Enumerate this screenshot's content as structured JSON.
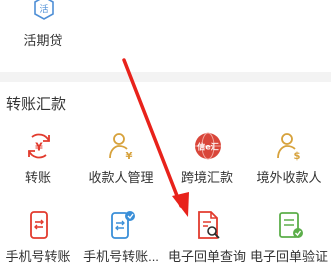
{
  "top": {
    "item_label": "活期贷",
    "icon_char": "活"
  },
  "section": {
    "title": "转账汇款"
  },
  "grid": {
    "row1": [
      {
        "label": "转账",
        "icon": "yen-transfer-icon"
      },
      {
        "label": "收款人管理",
        "icon": "payee-person-icon"
      },
      {
        "label": "跨境汇款",
        "icon": "globe-remit-icon",
        "badge": "信e汇"
      },
      {
        "label": "境外收款人",
        "icon": "overseas-payee-icon"
      }
    ],
    "row2": [
      {
        "label": "手机号转账",
        "icon": "phone-transfer-icon"
      },
      {
        "label": "手机号转账...",
        "icon": "phone-transfer-record-icon"
      },
      {
        "label": "电子回单查询",
        "icon": "receipt-search-icon"
      },
      {
        "label": "电子回单验证",
        "icon": "receipt-verify-icon"
      }
    ]
  },
  "colors": {
    "accent_red": "#e23b2e",
    "gold": "#d7a23c",
    "blue": "#3a8fd8",
    "green": "#5cae4a",
    "arrow": "#e8221b"
  }
}
